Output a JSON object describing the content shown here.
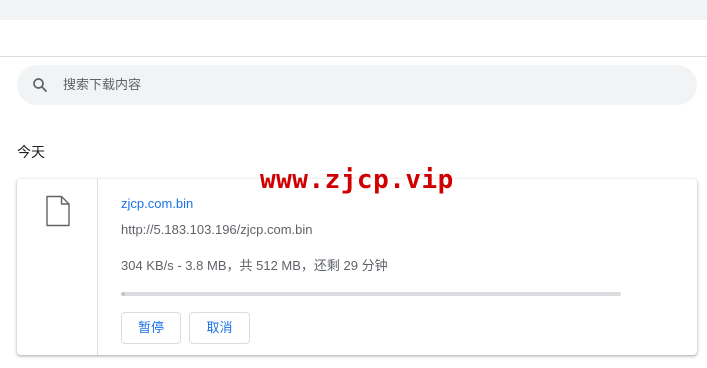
{
  "search": {
    "placeholder": "搜索下载内容"
  },
  "section": {
    "date_heading": "今天"
  },
  "download": {
    "file_name": "zjcp.com.bin",
    "url": "http://5.183.103.196/zjcp.com.bin",
    "progress_text": "304 KB/s - 3.8 MB，共 512 MB，还剩 29 分钟",
    "progress_fraction": 0.0074,
    "pause_label": "暂停",
    "cancel_label": "取消"
  },
  "watermark": {
    "text": "www.zjcp.vip"
  },
  "colors": {
    "accent": "#1a73e8",
    "search_bg": "#f1f3f4",
    "watermark": "#d00000"
  },
  "icons": {
    "search": "search-icon",
    "file": "file-icon"
  }
}
